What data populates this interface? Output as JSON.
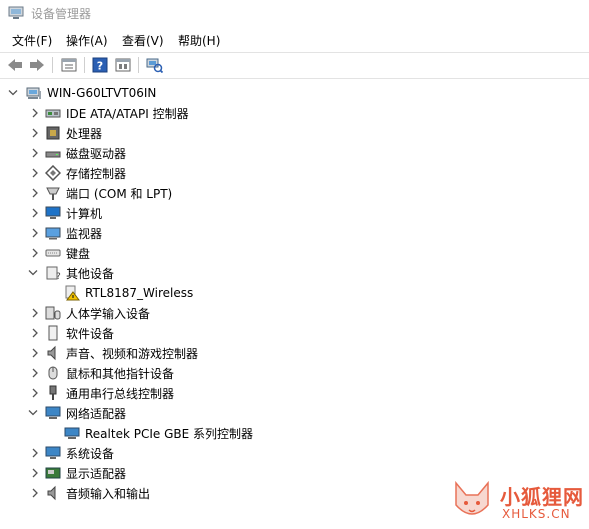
{
  "window": {
    "title": "设备管理器"
  },
  "menu": [
    {
      "label": "文件(F)"
    },
    {
      "label": "操作(A)"
    },
    {
      "label": "查看(V)"
    },
    {
      "label": "帮助(H)"
    }
  ],
  "toolbar": {
    "buttons": [
      "back-arrow-icon",
      "forward-arrow-icon",
      "properties-icon",
      "help-icon",
      "view-icon",
      "scan-hardware-icon"
    ]
  },
  "tree": {
    "root": {
      "label": "WIN-G60LTVT06IN",
      "icon": "computer-icon",
      "expanded": true
    },
    "items": [
      {
        "label": "IDE ATA/ATAPI 控制器",
        "icon": "ide-controller-icon",
        "expanded": false
      },
      {
        "label": "处理器",
        "icon": "processor-icon",
        "expanded": false
      },
      {
        "label": "磁盘驱动器",
        "icon": "disk-drive-icon",
        "expanded": false
      },
      {
        "label": "存储控制器",
        "icon": "storage-controller-icon",
        "expanded": false
      },
      {
        "label": "端口 (COM 和 LPT)",
        "icon": "port-icon",
        "expanded": false
      },
      {
        "label": "计算机",
        "icon": "monitor-icon",
        "expanded": false
      },
      {
        "label": "监视器",
        "icon": "display-monitor-icon",
        "expanded": false
      },
      {
        "label": "键盘",
        "icon": "keyboard-icon",
        "expanded": false
      },
      {
        "label": "其他设备",
        "icon": "unknown-device-icon",
        "expanded": true,
        "children": [
          {
            "label": "RTL8187_Wireless",
            "icon": "warning-device-icon"
          }
        ]
      },
      {
        "label": "人体学输入设备",
        "icon": "hid-icon",
        "expanded": false
      },
      {
        "label": "软件设备",
        "icon": "software-device-icon",
        "expanded": false
      },
      {
        "label": "声音、视频和游戏控制器",
        "icon": "speaker-icon",
        "expanded": false
      },
      {
        "label": "鼠标和其他指针设备",
        "icon": "mouse-icon",
        "expanded": false
      },
      {
        "label": "通用串行总线控制器",
        "icon": "usb-icon",
        "expanded": false
      },
      {
        "label": "网络适配器",
        "icon": "network-adapter-icon",
        "expanded": true,
        "children": [
          {
            "label": "Realtek PCIe GBE 系列控制器",
            "icon": "network-card-icon"
          }
        ]
      },
      {
        "label": "系统设备",
        "icon": "system-device-icon",
        "expanded": false
      },
      {
        "label": "显示适配器",
        "icon": "display-adapter-icon",
        "expanded": false
      },
      {
        "label": "音频输入和输出",
        "icon": "audio-io-icon",
        "expanded": false
      }
    ]
  },
  "watermark": {
    "text_cn": "小狐狸网",
    "text_en": "XHLKS.CN"
  },
  "colors": {
    "accent": "#e65a3c",
    "title_gray": "#9a9a9a",
    "icon_blue": "#1e73c8"
  }
}
